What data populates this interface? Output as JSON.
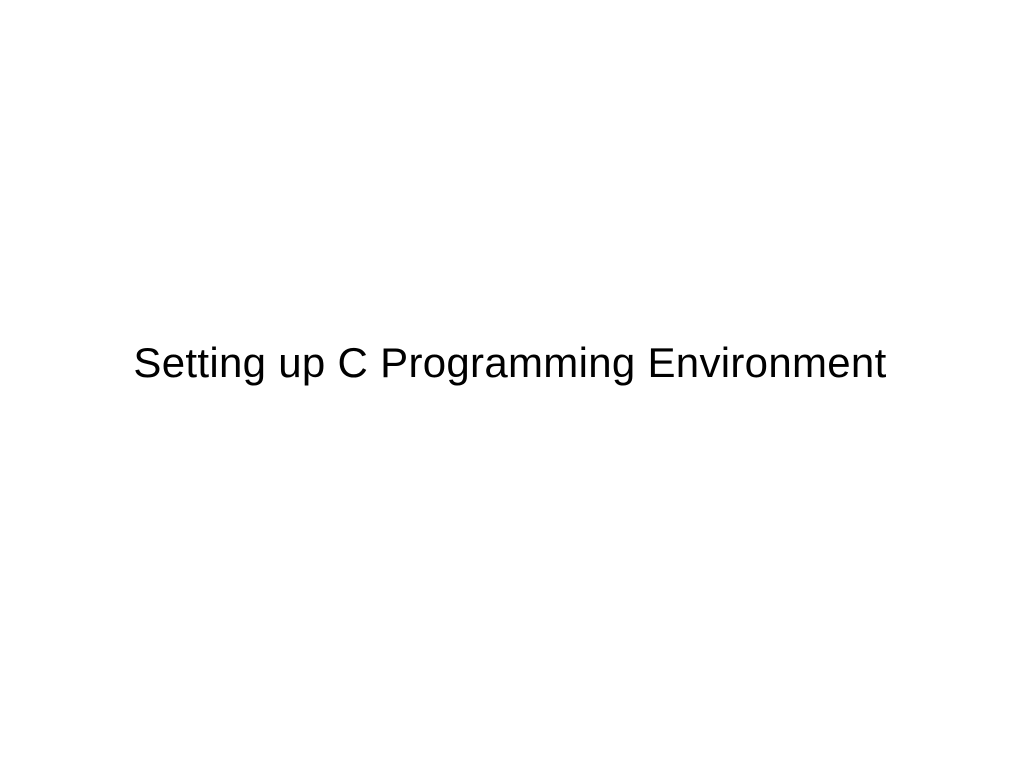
{
  "slide": {
    "title": "Setting up C Programming Environment"
  }
}
